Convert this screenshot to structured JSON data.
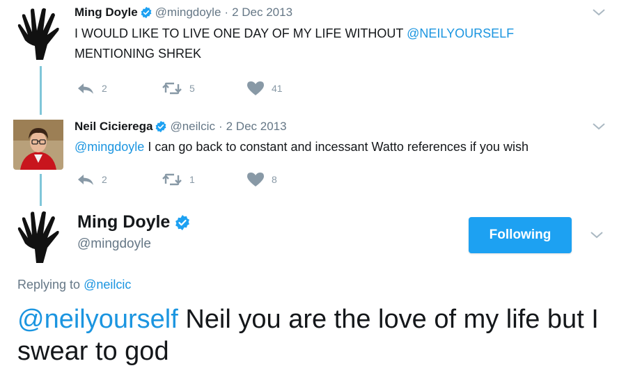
{
  "tweet1": {
    "name": "Ming Doyle",
    "handle": "@mingdoyle",
    "sep": "·",
    "date": "2 Dec 2013",
    "text_before": "I WOULD LIKE TO LIVE ONE DAY OF MY LIFE WITHOUT ",
    "mention": "@NEILYOURSELF",
    "text_after": "MENTIONING SHREK",
    "replies": "2",
    "retweets": "5",
    "likes": "41"
  },
  "tweet2": {
    "name": "Neil Cicierega",
    "handle": "@neilcic",
    "sep": "·",
    "date": "2 Dec 2013",
    "mention": "@mingdoyle",
    "text": " I can go back to constant and incessant Watto references if you wish",
    "replies": "2",
    "retweets": "1",
    "likes": "8"
  },
  "main": {
    "name": "Ming Doyle",
    "handle": "@mingdoyle",
    "follow_label": "Following",
    "replying_prefix": "Replying to ",
    "replying_to": "@neilcic",
    "mention": "@neilyourself",
    "text": " Neil you are the love of my life but I swear to god"
  },
  "colors": {
    "link": "#1b95e0",
    "verified": "#1da1f2",
    "thread_line": "#80c6d9",
    "button": "#1da1f2"
  },
  "icons": [
    "hand-avatar",
    "verified-badge-icon",
    "chevron-down-icon",
    "reply-icon",
    "retweet-icon",
    "heart-icon"
  ]
}
